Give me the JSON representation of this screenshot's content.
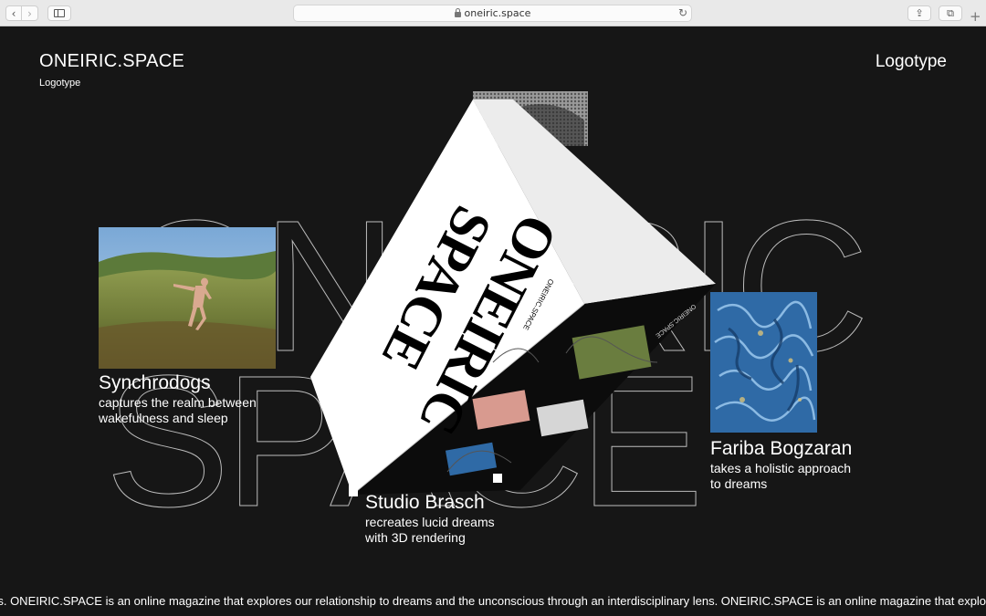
{
  "browser": {
    "url": "oneiric.space",
    "back_icon": "chevron-left-icon",
    "forward_icon": "chevron-right-icon",
    "share_icon": "share-icon",
    "tabs_icon": "tabs-overview-icon",
    "new_tab_icon": "plus-icon"
  },
  "header": {
    "site_title": "ONEIRIC.SPACE",
    "subtitle": "Logotype",
    "nav_link": "Logotype"
  },
  "background_word": {
    "line1": "ONEIRIC",
    "line2": "SPACE"
  },
  "projects": [
    {
      "name": "Synchrodogs",
      "desc_line1": "captures the realm between",
      "desc_line2": "wakefulness and sleep"
    },
    {
      "name": "Studio Brasch",
      "desc_line1": "recreates lucid dreams",
      "desc_line2": "with 3D rendering"
    },
    {
      "name": "Fariba Bogzaran",
      "desc_line1": "takes a holistic approach",
      "desc_line2": "to dreams"
    }
  ],
  "box": {
    "cover_line1": "ONEIRIC",
    "cover_line2": "SPACE",
    "spine_title": "ONEIRIC.SPACE"
  },
  "ticker": {
    "text": "lens. ONEIRIC.SPACE is an online magazine that explores our relationship to dreams and the unconscious through an interdisciplinary lens. ONEIRIC.SPACE is an online magazine that explores our relat"
  },
  "colors": {
    "background": "#161616",
    "text": "#ffffff",
    "outline": "#bdbdbd"
  }
}
